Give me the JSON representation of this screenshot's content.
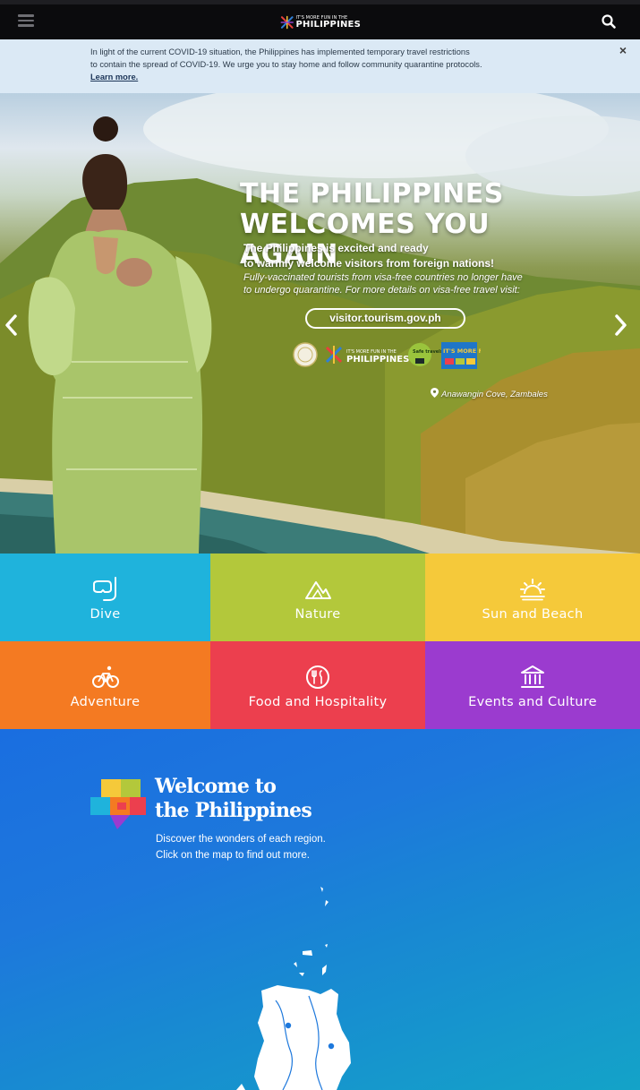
{
  "topbar": {
    "logo_small": "IT'S MORE FUN IN THE",
    "logo_big": "PHILIPPINES"
  },
  "notice": {
    "text": "In light of the current COVID-19 situation, the Philippines has implemented temporary travel restrictions\nto contain the spread of COVID-19. We urge you to stay home and follow community quarantine protocols.",
    "link": "Learn more.",
    "close": "×"
  },
  "hero": {
    "title": "THE PHILIPPINES\nWELCOMES YOU AGAIN",
    "subtitle": "The Philippines is excited and ready\nto warmly welcome visitors from foreign nations!",
    "italic": "Fully-vaccinated tourists from visa-free countries no longer have\nto undergo quarantine. For more details on visa-free travel visit:",
    "url": "visitor.tourism.gov.ph",
    "location": "Anawangin Cove, Zambales",
    "logo_small": "IT'S MORE FUN IN THE",
    "logo_big": "PHILIPPINES",
    "safe_travels": "Safe travels",
    "more_fun": "IT'S MORE FUN"
  },
  "categories": [
    {
      "label": "Dive",
      "color": "#1fb3dc",
      "icon": "snorkel-icon",
      "icon_color": "#ffffff"
    },
    {
      "label": "Nature",
      "color": "#b3c83b",
      "icon": "mountain-icon",
      "icon_color": "#ffffff"
    },
    {
      "label": "Sun and Beach",
      "color": "#f5c93a",
      "icon": "sun-icon",
      "icon_color": "#ffffff"
    },
    {
      "label": "Adventure",
      "color": "#f47a22",
      "icon": "bicycle-icon",
      "icon_color": "#ffffff"
    },
    {
      "label": "Food and Hospitality",
      "color": "#ec3f4e",
      "icon": "food-icon",
      "icon_color": "#ffffff"
    },
    {
      "label": "Events and Culture",
      "color": "#9b3bcf",
      "icon": "museum-icon",
      "icon_color": "#ffffff"
    }
  ],
  "welcome": {
    "title": "Welcome to\nthe Philippines",
    "text": "Discover the wonders of each region.\nClick on the map to find out more."
  }
}
